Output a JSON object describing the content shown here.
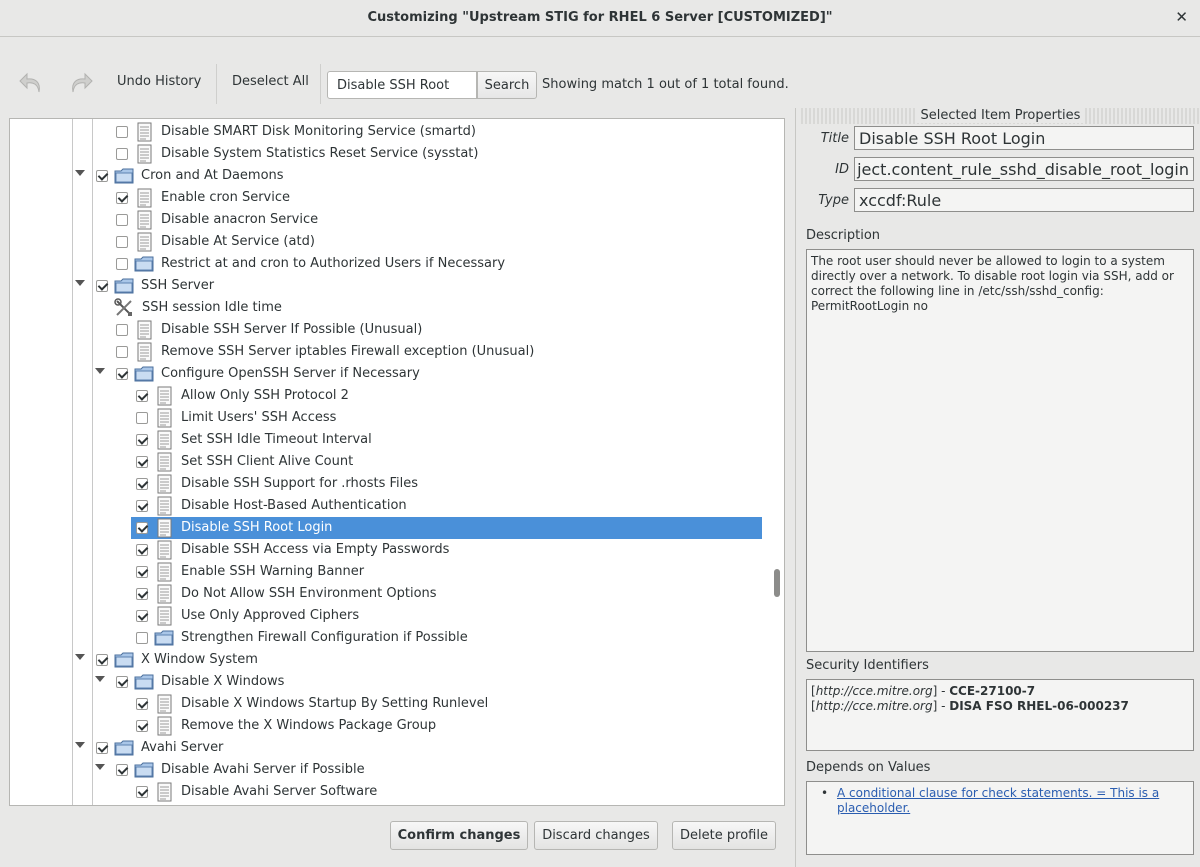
{
  "window": {
    "title": "Customizing \"Upstream STIG for RHEL 6 Server [CUSTOMIZED]\"",
    "close_glyph": "✕"
  },
  "toolbar": {
    "undo_icon": "undo-arrow-icon",
    "redo_icon": "redo-arrow-icon",
    "undo_history": "Undo History",
    "deselect_all": "Deselect All",
    "search_value": "Disable SSH Root",
    "search_button": "Search",
    "match_text": "Showing match 1 out of 1 total found."
  },
  "tree": [
    {
      "label": "Disable SMART Disk Monitoring Service (smartd)",
      "depth": 2,
      "type": "rule",
      "checked": false
    },
    {
      "label": "Disable System Statistics Reset Service (sysstat)",
      "depth": 2,
      "type": "rule",
      "checked": false
    },
    {
      "label": "Cron and At Daemons",
      "depth": 1,
      "type": "group",
      "checked": true,
      "expanded": true
    },
    {
      "label": "Enable cron Service",
      "depth": 2,
      "type": "rule",
      "checked": true
    },
    {
      "label": "Disable anacron Service",
      "depth": 2,
      "type": "rule",
      "checked": false
    },
    {
      "label": "Disable At Service (atd)",
      "depth": 2,
      "type": "rule",
      "checked": false
    },
    {
      "label": "Restrict at and cron to Authorized Users if Necessary",
      "depth": 2,
      "type": "group",
      "checked": false,
      "expanded": false
    },
    {
      "label": "SSH Server",
      "depth": 1,
      "type": "group",
      "checked": true,
      "expanded": true
    },
    {
      "label": "SSH session Idle time",
      "depth": 2,
      "type": "value",
      "checked": null
    },
    {
      "label": "Disable SSH Server If Possible (Unusual)",
      "depth": 2,
      "type": "rule",
      "checked": false
    },
    {
      "label": "Remove SSH Server iptables Firewall exception (Unusual)",
      "depth": 2,
      "type": "rule",
      "checked": false
    },
    {
      "label": "Configure OpenSSH Server if Necessary",
      "depth": 2,
      "type": "group",
      "checked": true,
      "expanded": true
    },
    {
      "label": "Allow Only SSH Protocol 2",
      "depth": 3,
      "type": "rule",
      "checked": true
    },
    {
      "label": "Limit Users' SSH Access",
      "depth": 3,
      "type": "rule",
      "checked": false
    },
    {
      "label": "Set SSH Idle Timeout Interval",
      "depth": 3,
      "type": "rule",
      "checked": true
    },
    {
      "label": "Set SSH Client Alive Count",
      "depth": 3,
      "type": "rule",
      "checked": true
    },
    {
      "label": "Disable SSH Support for .rhosts Files",
      "depth": 3,
      "type": "rule",
      "checked": true
    },
    {
      "label": "Disable Host-Based Authentication",
      "depth": 3,
      "type": "rule",
      "checked": true
    },
    {
      "label": "Disable SSH Root Login",
      "depth": 3,
      "type": "rule",
      "checked": true,
      "selected": true
    },
    {
      "label": "Disable SSH Access via Empty Passwords",
      "depth": 3,
      "type": "rule",
      "checked": true
    },
    {
      "label": "Enable SSH Warning Banner",
      "depth": 3,
      "type": "rule",
      "checked": true
    },
    {
      "label": "Do Not Allow SSH Environment Options",
      "depth": 3,
      "type": "rule",
      "checked": true
    },
    {
      "label": "Use Only Approved Ciphers",
      "depth": 3,
      "type": "rule",
      "checked": true
    },
    {
      "label": "Strengthen Firewall Configuration if Possible",
      "depth": 3,
      "type": "group",
      "checked": false,
      "expanded": false
    },
    {
      "label": "X Window System",
      "depth": 1,
      "type": "group",
      "checked": true,
      "expanded": true
    },
    {
      "label": "Disable X Windows",
      "depth": 2,
      "type": "group",
      "checked": true,
      "expanded": true
    },
    {
      "label": "Disable X Windows Startup By Setting Runlevel",
      "depth": 3,
      "type": "rule",
      "checked": true
    },
    {
      "label": "Remove the X Windows Package Group",
      "depth": 3,
      "type": "rule",
      "checked": true
    },
    {
      "label": "Avahi Server",
      "depth": 1,
      "type": "group",
      "checked": true,
      "expanded": true
    },
    {
      "label": "Disable Avahi Server if Possible",
      "depth": 2,
      "type": "group",
      "checked": true,
      "expanded": true
    },
    {
      "label": "Disable Avahi Server Software",
      "depth": 3,
      "type": "rule",
      "checked": true
    }
  ],
  "actions": {
    "confirm": "Confirm changes",
    "discard": "Discard changes",
    "delete": "Delete profile"
  },
  "properties": {
    "header": "Selected Item Properties",
    "title_label": "Title",
    "title_value": "Disable SSH Root Login",
    "id_label": "ID",
    "id_value": "ject.content_rule_sshd_disable_root_login",
    "type_label": "Type",
    "type_value": "xccdf:Rule",
    "description_label": "Description",
    "description": "The root user should never be allowed to login to a system directly over a network. To disable root login via SSH, add or correct the following line in /etc/ssh/sshd_config: PermitRootLogin no",
    "security_label": "Security Identifiers",
    "identifiers": [
      {
        "system": "http://cce.mitre.org",
        "id": "CCE-27100-7"
      },
      {
        "system": "http://cce.mitre.org",
        "id": "DISA FSO RHEL-06-000237"
      }
    ],
    "depends_label": "Depends on Values",
    "depends_link": "A conditional clause for check statements. = This is a placeholder."
  },
  "colors": {
    "selection": "#4a90d9",
    "link": "#2a5db0"
  }
}
